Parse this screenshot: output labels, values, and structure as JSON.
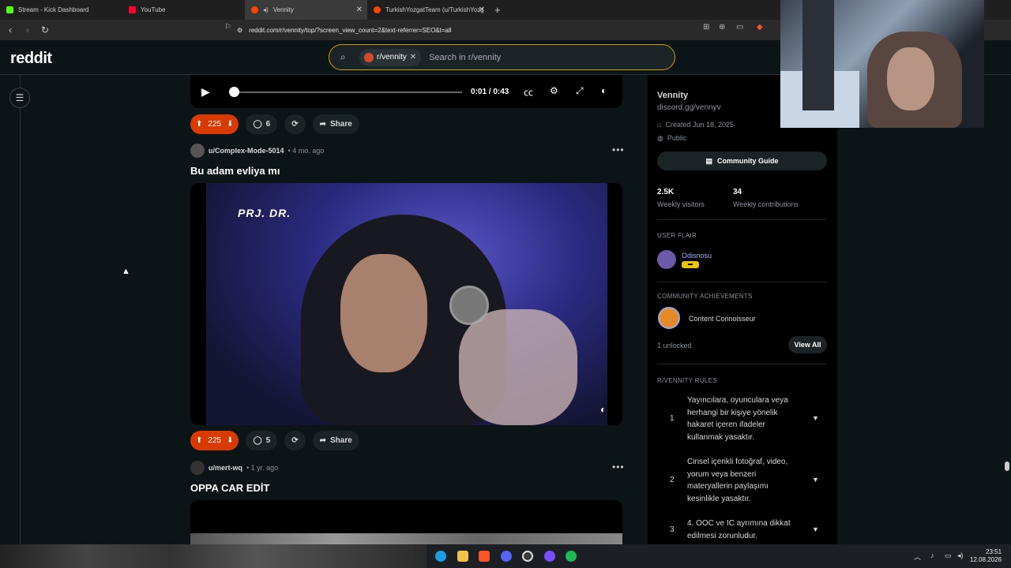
{
  "browser": {
    "tabs": [
      {
        "label": "Stream - Kick Dashboard",
        "color": "#53fc18"
      },
      {
        "label": "YouTube",
        "color": "#ff0033"
      },
      {
        "label": "Vennity",
        "color": "#ff4500"
      },
      {
        "label": "TurkishYozgatTeam (u/TurkishYozgat",
        "color": "#ff4500"
      }
    ],
    "url": "reddit.com/r/vennity/top/?screen_view_count=2&text-referrer=SEO&t=all"
  },
  "header": {
    "logo": "reddit",
    "search_chip": "r/vennity",
    "search_placeholder": "Search in r/vennity"
  },
  "player": {
    "time": "0:01 / 0:43"
  },
  "posts": [
    {
      "upvotes": "225",
      "comments": "6",
      "share": "Share"
    },
    {
      "author": "u/Complex-Mode-5014",
      "age": "4 mo. ago",
      "title": "Bu adam evliya mı",
      "watermark": "PRJ. DR.",
      "upvotes": "225",
      "comments": "5",
      "share": "Share"
    },
    {
      "author": "u/mert-wq",
      "age": "1 yr. ago",
      "title": "OPPA CAR EDİT"
    }
  ],
  "sidebar": {
    "name": "Vennity",
    "link": "discord.gg/vennyv",
    "created": "Created Jun 18, 2025",
    "visibility": "Public",
    "guide_button": "Community Guide",
    "visitors_value": "2.5K",
    "visitors_label": "Weekly visitors",
    "contrib_value": "34",
    "contrib_label": "Weekly contributions",
    "flair_heading": "USER FLAIR",
    "flair_name": "Odisnosu",
    "achievements_heading": "COMMUNITY ACHIEVEMENTS",
    "achievement": "Content Connoisseur",
    "unlocked": "1 unlocked",
    "view_all": "View All",
    "rules_heading": "R/VENNITY RULES",
    "rules": [
      {
        "num": "1",
        "text": "Yayıncılara, oyunculara veya herhangi bir kişiye yönelik hakaret içeren ifadeler kullanmak yasaktır."
      },
      {
        "num": "2",
        "text": "Cinsel içerikli fotoğraf, video, yorum veya benzeri materyallerin paylaşımı kesinlikle yasaktır."
      },
      {
        "num": "3",
        "text": "4. OOC ve IC ayrımına dikkat edilmesi zorunludur."
      }
    ]
  },
  "taskbar": {
    "time": "23:51",
    "date": "12.08.2026"
  }
}
